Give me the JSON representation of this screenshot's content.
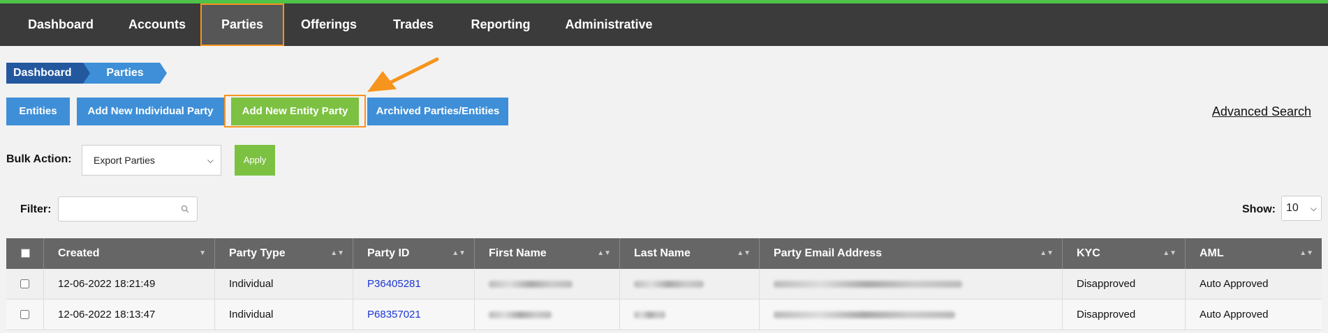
{
  "nav": {
    "items": [
      {
        "label": "Dashboard"
      },
      {
        "label": "Accounts"
      },
      {
        "label": "Parties"
      },
      {
        "label": "Offerings"
      },
      {
        "label": "Trades"
      },
      {
        "label": "Reporting"
      },
      {
        "label": "Administrative"
      }
    ],
    "active": "Parties"
  },
  "breadcrumb": [
    "Dashboard",
    "Parties"
  ],
  "actions": {
    "entities": "Entities",
    "add_individual": "Add New Individual Party",
    "add_entity": "Add New Entity Party",
    "archived": "Archived Parties/Entities",
    "advanced_search": "Advanced Search"
  },
  "bulk": {
    "label": "Bulk Action:",
    "selected": "Export Parties",
    "apply": "Apply"
  },
  "filter": {
    "label": "Filter:",
    "value": ""
  },
  "show": {
    "label": "Show:",
    "value": "10"
  },
  "table": {
    "columns": [
      "Created",
      "Party Type",
      "Party ID",
      "First Name",
      "Last Name",
      "Party Email Address",
      "KYC",
      "AML"
    ],
    "rows": [
      {
        "created": "12-06-2022 18:21:49",
        "type": "Individual",
        "id": "P36405281",
        "kyc": "Disapproved",
        "aml": "Auto Approved"
      },
      {
        "created": "12-06-2022 18:13:47",
        "type": "Individual",
        "id": "P68357021",
        "kyc": "Disapproved",
        "aml": "Auto Approved"
      }
    ]
  },
  "colors": {
    "nav_bg": "#3b3b3b",
    "accent_green": "#7cc142",
    "accent_blue": "#3e8fd8",
    "highlight_orange": "#f7941d",
    "link_blue": "#1a35d6"
  }
}
